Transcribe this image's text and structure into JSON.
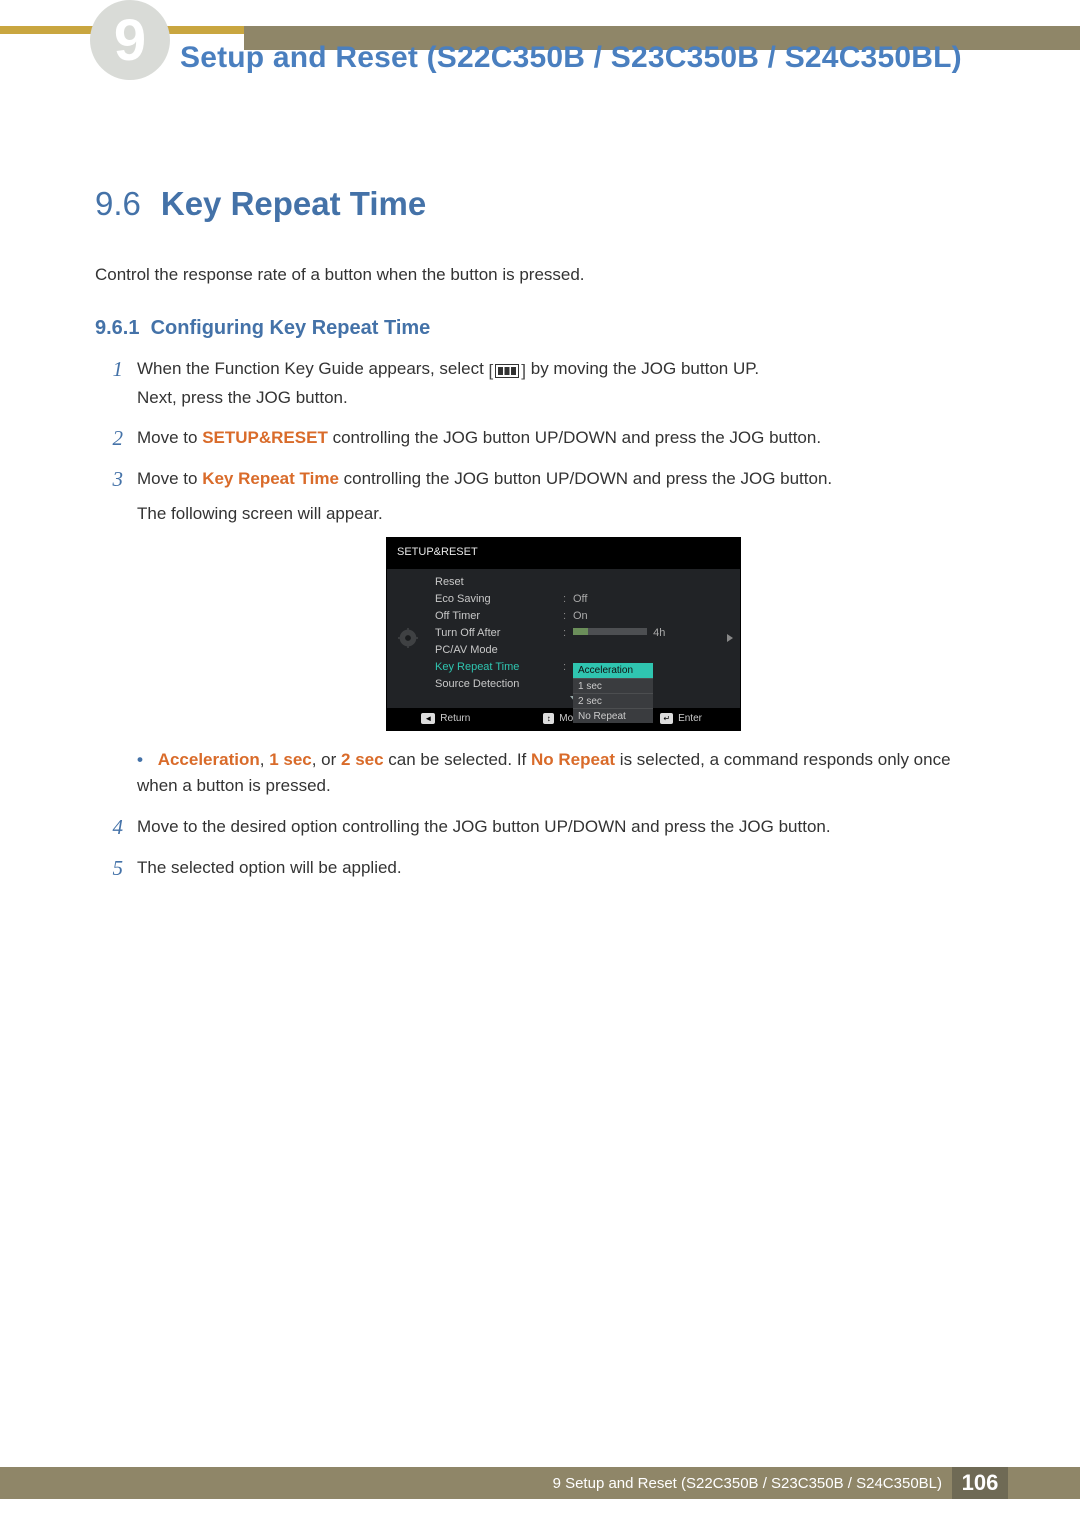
{
  "chapter_number_cap": "9",
  "page_title": "Setup and Reset (S22C350B / S23C350B / S24C350BL)",
  "section": {
    "number": "9.6",
    "title": "Key Repeat Time"
  },
  "intro": "Control the response rate of a button when the button is pressed.",
  "subsection": {
    "number": "9.6.1",
    "title": "Configuring Key Repeat Time"
  },
  "steps": {
    "s1a": "When the Function Key Guide appears, select",
    "s1b": "by moving the JOG button UP.",
    "s1c": "Next, press the JOG button.",
    "s2a": "Move to ",
    "s2_em": "SETUP&RESET",
    "s2b": " controlling the JOG button UP/DOWN and press the JOG button.",
    "s3a": "Move to ",
    "s3_em": "Key Repeat Time",
    "s3b": " controlling the JOG button UP/DOWN and press the JOG button.",
    "s3c": "The following screen will appear.",
    "s4": "Move to the desired option controlling the JOG button UP/DOWN and press the JOG button.",
    "s5": "The selected option will be applied."
  },
  "note": {
    "em1": "Acceleration",
    "em2": "1 sec",
    "t1": ", or ",
    "em3": "2 sec",
    "t2": " can be selected. If ",
    "em4": "No Repeat",
    "t3": " is selected, a command responds only once when a button is pressed."
  },
  "osd": {
    "title": "SETUP&RESET",
    "rows": [
      {
        "label": "Reset",
        "value": ""
      },
      {
        "label": "Eco Saving",
        "value": "Off"
      },
      {
        "label": "Off Timer",
        "value": "On"
      },
      {
        "label": "Turn Off After",
        "value": "4h",
        "bar": true
      },
      {
        "label": "PC/AV Mode",
        "value": ""
      },
      {
        "label": "Key Repeat Time",
        "value": "",
        "hl": true
      },
      {
        "label": "Source Detection",
        "value": ""
      }
    ],
    "options": [
      "Acceleration",
      "1 sec",
      "2 sec",
      "No Repeat"
    ],
    "footer": {
      "return": "Return",
      "move": "Move",
      "enter": "Enter"
    }
  },
  "footer": {
    "path": "9 Setup and Reset (S22C350B / S23C350B / S24C350BL)",
    "page": "106"
  }
}
